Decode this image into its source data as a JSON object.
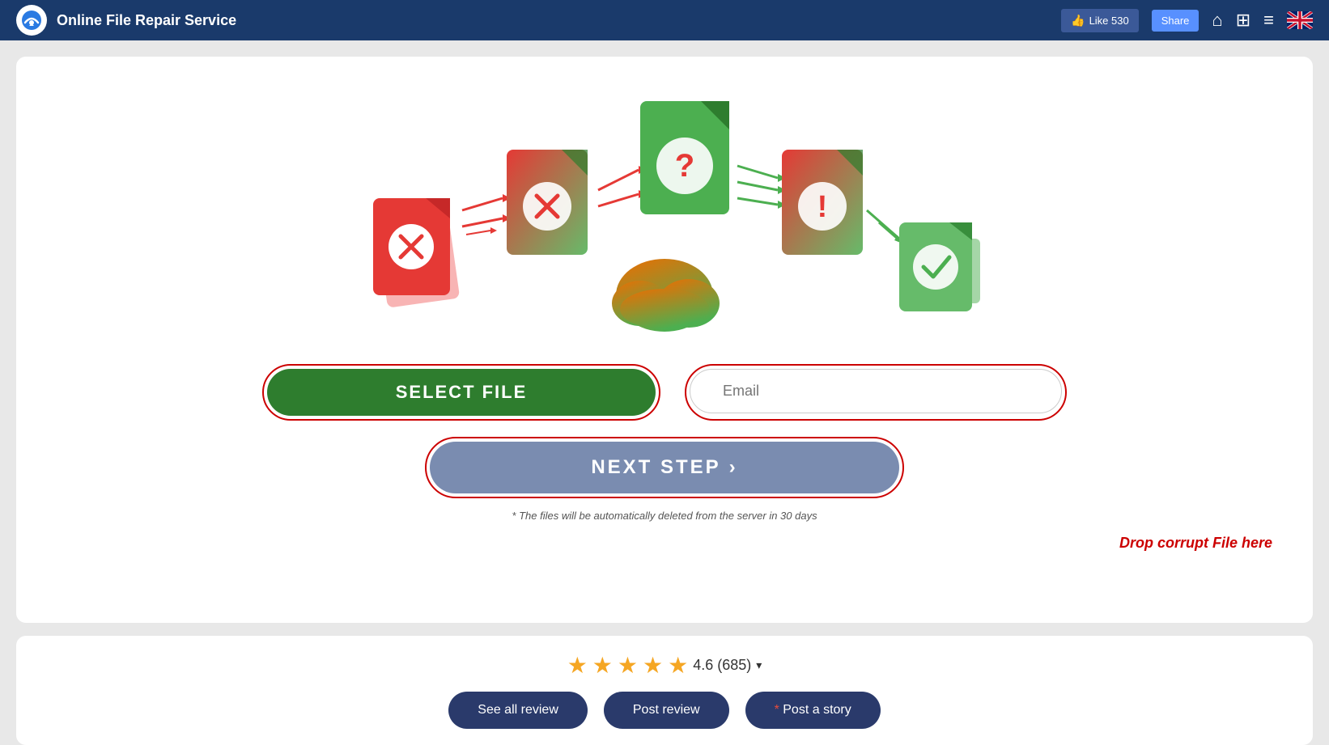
{
  "header": {
    "logo_alt": "Online File Repair Service logo",
    "title": "Online File Repair Service",
    "fb_like_label": "Like 530",
    "fb_share_label": "Share",
    "home_icon": "⌂",
    "grid_icon": "⊞",
    "menu_icon": "≡",
    "flag_icon": "🇬🇧"
  },
  "upload_card": {
    "select_file_label": "SELECT FILE",
    "email_placeholder": "Email",
    "next_step_label": "NEXT STEP",
    "next_step_chevron": "›",
    "auto_delete_note": "* The files will be automatically deleted from the server in 30 days",
    "drop_hint": "Drop corrupt File here"
  },
  "review_section": {
    "stars": [
      "★",
      "★",
      "★",
      "★",
      "★"
    ],
    "rating": "4.6 (685)",
    "rating_arrow": "▾",
    "see_all_label": "See all review",
    "post_review_label": "Post review",
    "post_story_asterisk": "*",
    "post_story_label": " Post a story"
  }
}
